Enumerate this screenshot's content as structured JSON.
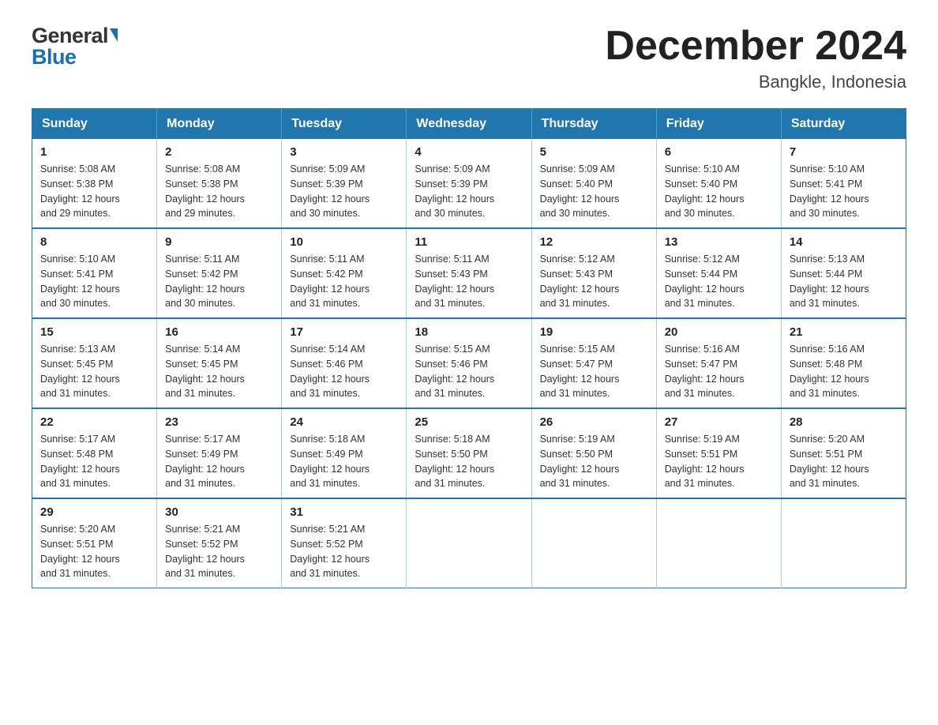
{
  "logo": {
    "general": "General",
    "triangle": "▶",
    "blue": "Blue"
  },
  "title": "December 2024",
  "subtitle": "Bangkle, Indonesia",
  "days": [
    "Sunday",
    "Monday",
    "Tuesday",
    "Wednesday",
    "Thursday",
    "Friday",
    "Saturday"
  ],
  "weeks": [
    [
      {
        "date": "1",
        "sunrise": "5:08 AM",
        "sunset": "5:38 PM",
        "daylight": "12 hours and 29 minutes."
      },
      {
        "date": "2",
        "sunrise": "5:08 AM",
        "sunset": "5:38 PM",
        "daylight": "12 hours and 29 minutes."
      },
      {
        "date": "3",
        "sunrise": "5:09 AM",
        "sunset": "5:39 PM",
        "daylight": "12 hours and 30 minutes."
      },
      {
        "date": "4",
        "sunrise": "5:09 AM",
        "sunset": "5:39 PM",
        "daylight": "12 hours and 30 minutes."
      },
      {
        "date": "5",
        "sunrise": "5:09 AM",
        "sunset": "5:40 PM",
        "daylight": "12 hours and 30 minutes."
      },
      {
        "date": "6",
        "sunrise": "5:10 AM",
        "sunset": "5:40 PM",
        "daylight": "12 hours and 30 minutes."
      },
      {
        "date": "7",
        "sunrise": "5:10 AM",
        "sunset": "5:41 PM",
        "daylight": "12 hours and 30 minutes."
      }
    ],
    [
      {
        "date": "8",
        "sunrise": "5:10 AM",
        "sunset": "5:41 PM",
        "daylight": "12 hours and 30 minutes."
      },
      {
        "date": "9",
        "sunrise": "5:11 AM",
        "sunset": "5:42 PM",
        "daylight": "12 hours and 30 minutes."
      },
      {
        "date": "10",
        "sunrise": "5:11 AM",
        "sunset": "5:42 PM",
        "daylight": "12 hours and 31 minutes."
      },
      {
        "date": "11",
        "sunrise": "5:11 AM",
        "sunset": "5:43 PM",
        "daylight": "12 hours and 31 minutes."
      },
      {
        "date": "12",
        "sunrise": "5:12 AM",
        "sunset": "5:43 PM",
        "daylight": "12 hours and 31 minutes."
      },
      {
        "date": "13",
        "sunrise": "5:12 AM",
        "sunset": "5:44 PM",
        "daylight": "12 hours and 31 minutes."
      },
      {
        "date": "14",
        "sunrise": "5:13 AM",
        "sunset": "5:44 PM",
        "daylight": "12 hours and 31 minutes."
      }
    ],
    [
      {
        "date": "15",
        "sunrise": "5:13 AM",
        "sunset": "5:45 PM",
        "daylight": "12 hours and 31 minutes."
      },
      {
        "date": "16",
        "sunrise": "5:14 AM",
        "sunset": "5:45 PM",
        "daylight": "12 hours and 31 minutes."
      },
      {
        "date": "17",
        "sunrise": "5:14 AM",
        "sunset": "5:46 PM",
        "daylight": "12 hours and 31 minutes."
      },
      {
        "date": "18",
        "sunrise": "5:15 AM",
        "sunset": "5:46 PM",
        "daylight": "12 hours and 31 minutes."
      },
      {
        "date": "19",
        "sunrise": "5:15 AM",
        "sunset": "5:47 PM",
        "daylight": "12 hours and 31 minutes."
      },
      {
        "date": "20",
        "sunrise": "5:16 AM",
        "sunset": "5:47 PM",
        "daylight": "12 hours and 31 minutes."
      },
      {
        "date": "21",
        "sunrise": "5:16 AM",
        "sunset": "5:48 PM",
        "daylight": "12 hours and 31 minutes."
      }
    ],
    [
      {
        "date": "22",
        "sunrise": "5:17 AM",
        "sunset": "5:48 PM",
        "daylight": "12 hours and 31 minutes."
      },
      {
        "date": "23",
        "sunrise": "5:17 AM",
        "sunset": "5:49 PM",
        "daylight": "12 hours and 31 minutes."
      },
      {
        "date": "24",
        "sunrise": "5:18 AM",
        "sunset": "5:49 PM",
        "daylight": "12 hours and 31 minutes."
      },
      {
        "date": "25",
        "sunrise": "5:18 AM",
        "sunset": "5:50 PM",
        "daylight": "12 hours and 31 minutes."
      },
      {
        "date": "26",
        "sunrise": "5:19 AM",
        "sunset": "5:50 PM",
        "daylight": "12 hours and 31 minutes."
      },
      {
        "date": "27",
        "sunrise": "5:19 AM",
        "sunset": "5:51 PM",
        "daylight": "12 hours and 31 minutes."
      },
      {
        "date": "28",
        "sunrise": "5:20 AM",
        "sunset": "5:51 PM",
        "daylight": "12 hours and 31 minutes."
      }
    ],
    [
      {
        "date": "29",
        "sunrise": "5:20 AM",
        "sunset": "5:51 PM",
        "daylight": "12 hours and 31 minutes."
      },
      {
        "date": "30",
        "sunrise": "5:21 AM",
        "sunset": "5:52 PM",
        "daylight": "12 hours and 31 minutes."
      },
      {
        "date": "31",
        "sunrise": "5:21 AM",
        "sunset": "5:52 PM",
        "daylight": "12 hours and 31 minutes."
      },
      null,
      null,
      null,
      null
    ]
  ],
  "labels": {
    "sunrise": "Sunrise:",
    "sunset": "Sunset:",
    "daylight": "Daylight:"
  },
  "colors": {
    "header_bg": "#2176ae",
    "header_text": "#ffffff",
    "border": "#2176ae",
    "cell_border": "#aacce0"
  }
}
